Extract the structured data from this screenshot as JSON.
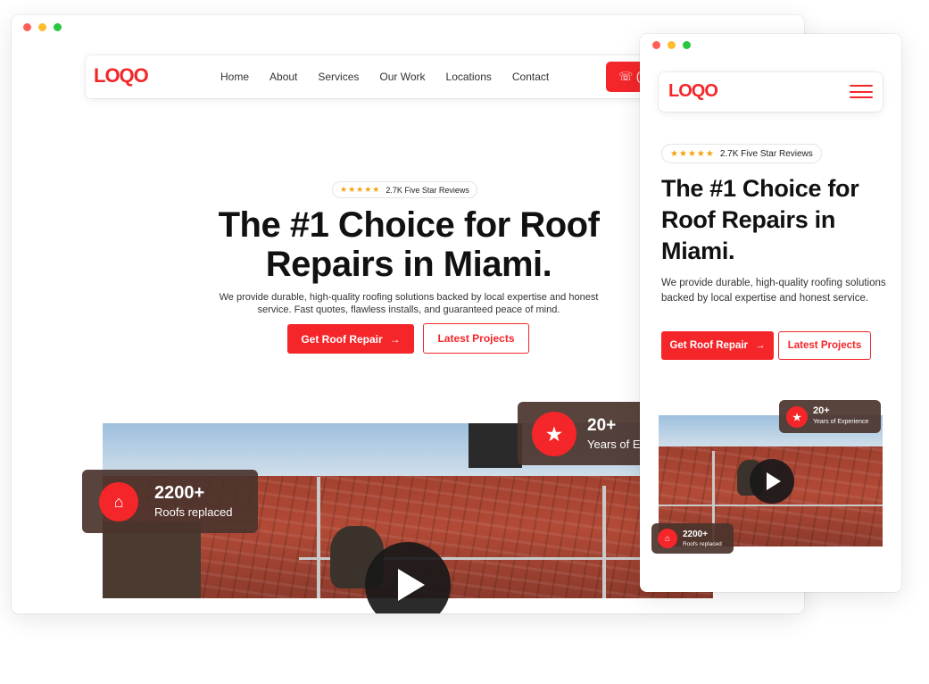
{
  "brand": {
    "logo_text": "LOQO",
    "accent": "#f4262a"
  },
  "desktop": {
    "nav": {
      "links": [
        "Home",
        "About",
        "Services",
        "Our Work",
        "Locations",
        "Contact"
      ],
      "call_button_glyph": "☏ ("
    },
    "reviews": {
      "stars": "★★★★★",
      "text": "2.7K Five Star Reviews"
    },
    "hero": {
      "title": "The #1 Choice for Roof Repairs in Miami.",
      "subtitle": "We provide durable, high-quality roofing solutions backed by local expertise and honest service. Fast quotes, flawless installs, and guaranteed peace of mind."
    },
    "buttons": {
      "primary": "Get Roof Repair",
      "secondary": "Latest Projects"
    },
    "stats": {
      "roofs": {
        "value": "2200+",
        "label": "Roofs replaced"
      },
      "years": {
        "value": "20+",
        "label": "Years of E"
      }
    }
  },
  "mobile": {
    "reviews": {
      "stars": "★★★★★",
      "text": "2.7K Five Star Reviews"
    },
    "hero": {
      "title": "The #1 Choice for Roof Repairs in Miami.",
      "subtitle": "We provide durable, high-quality roofing solutions backed by local expertise and honest service."
    },
    "buttons": {
      "primary": "Get Roof Repair",
      "secondary": "Latest Projects"
    },
    "stats": {
      "years": {
        "value": "20+",
        "label": "Years of Experience"
      },
      "roofs": {
        "value": "2200+",
        "label": "Roofs replaced"
      }
    }
  },
  "icons": {
    "arrow": "→",
    "home": "⌂",
    "badge": "★",
    "menu": "hamburger-icon",
    "play": "play-icon",
    "phone": "phone-icon"
  }
}
